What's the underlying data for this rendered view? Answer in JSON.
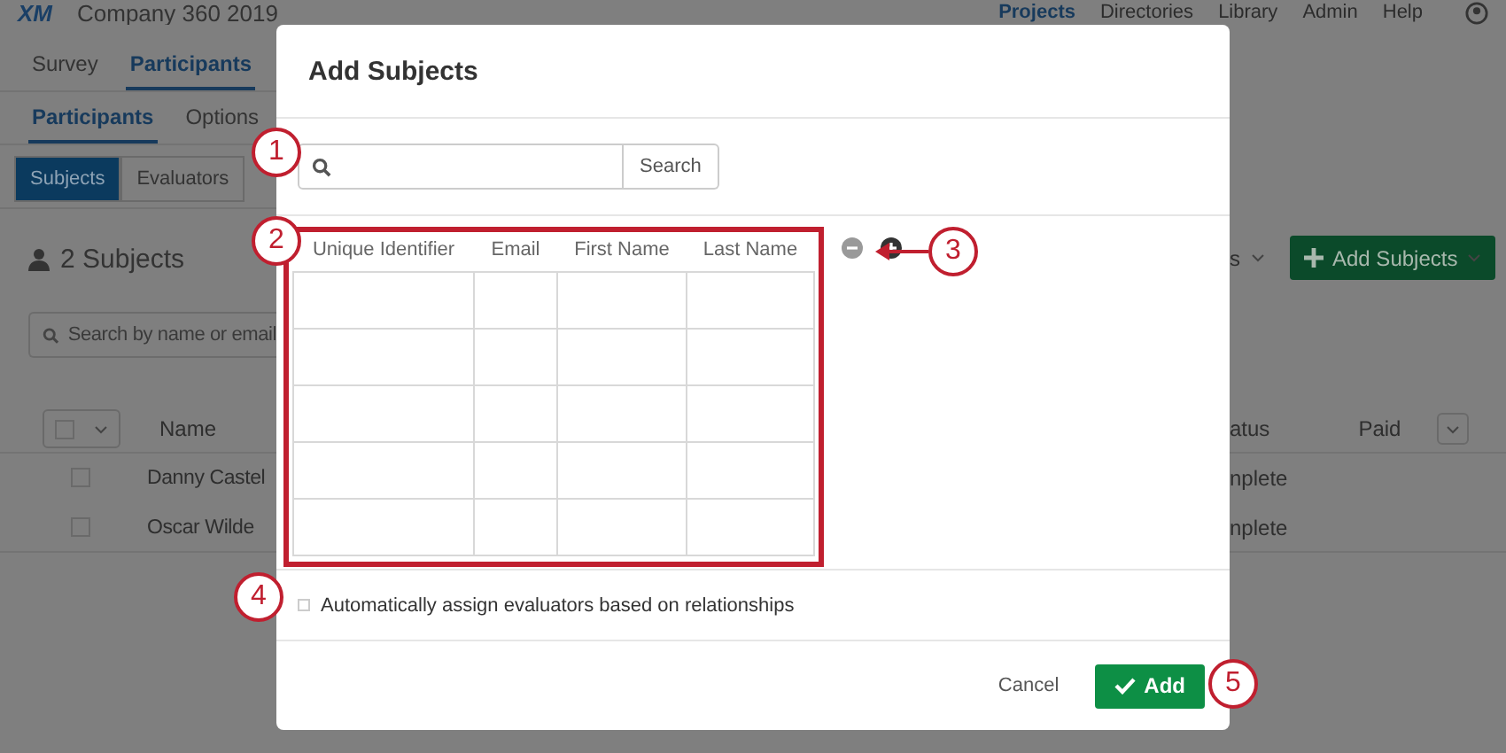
{
  "header": {
    "logo": "XM",
    "title": "Company 360 2019",
    "nav": [
      {
        "label": "Projects",
        "selected": true
      },
      {
        "label": "Directories",
        "selected": false
      },
      {
        "label": "Library",
        "selected": false
      },
      {
        "label": "Admin",
        "selected": false
      },
      {
        "label": "Help",
        "selected": false
      }
    ]
  },
  "tabs": [
    {
      "label": "Survey",
      "selected": false
    },
    {
      "label": "Participants",
      "selected": true
    }
  ],
  "subtabs": [
    {
      "label": "Participants",
      "selected": true
    },
    {
      "label": "Options",
      "selected": false
    }
  ],
  "segments": [
    {
      "label": "Subjects",
      "selected": true
    },
    {
      "label": "Evaluators",
      "selected": false
    }
  ],
  "subject_count": "2 Subjects",
  "search": {
    "placeholder": "Search by name or email"
  },
  "toolbar": {
    "dropdown": "s",
    "add_button": "Add Subjects"
  },
  "list_header": {
    "select_all": {
      "checked": false
    },
    "column_1": "Name",
    "column_2": "atus",
    "column_3": "Paid"
  },
  "rows": [
    {
      "name": "Danny Castel",
      "status": "nplete",
      "checked": false
    },
    {
      "name": "Oscar Wilde",
      "status": "nplete",
      "checked": false
    }
  ],
  "dialog": {
    "title": "Add Subjects",
    "search_button": "Search",
    "columns": [
      "Unique Identifier",
      "Email",
      "First Name",
      "Last Name"
    ],
    "auto_assign": {
      "label": "Automatically assign evaluators based on relationships",
      "checked": false
    },
    "cancel": "Cancel",
    "add": "Add"
  },
  "callouts": [
    "1",
    "2",
    "3",
    "4",
    "5"
  ]
}
